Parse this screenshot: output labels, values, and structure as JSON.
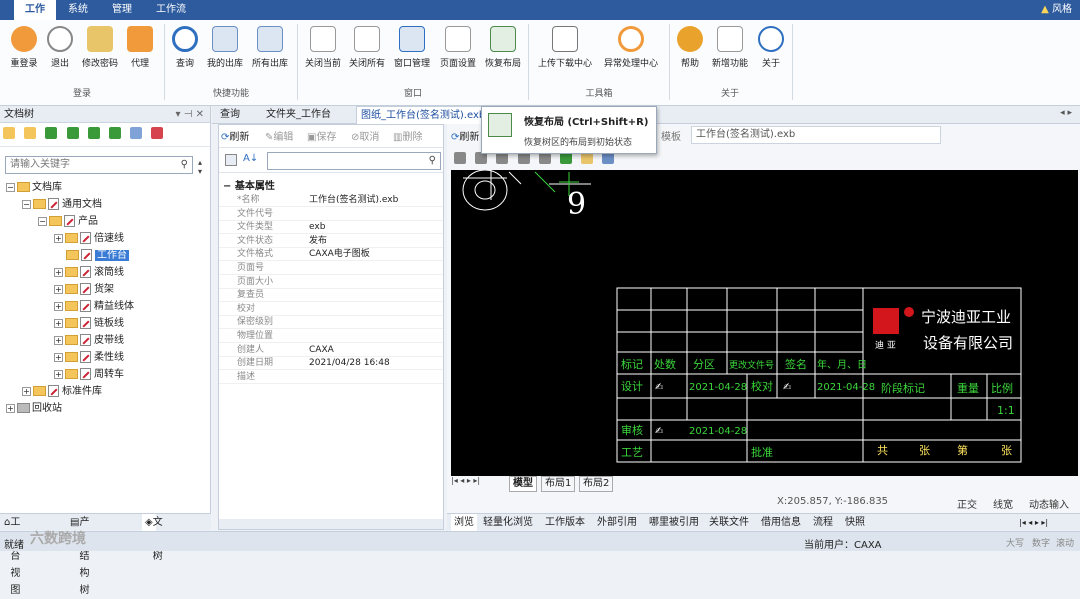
{
  "menubar": {
    "tabs": [
      "工作",
      "系统",
      "管理",
      "工作流"
    ],
    "style": "风格"
  },
  "ribbon": {
    "buttons": [
      "重登录",
      "退出",
      "修改密码",
      "代理",
      "查询",
      "我的出库",
      "所有出库",
      "关闭当前",
      "关闭所有",
      "窗口管理",
      "页面设置",
      "恢复布局",
      "上传下载中心",
      "异常处理中心",
      "帮助",
      "新增功能",
      "关于"
    ],
    "groups": [
      "登录",
      "快捷功能",
      "窗口",
      "工具箱",
      "关于"
    ]
  },
  "tree": {
    "title": "文档树",
    "search_placeholder": "请输入关键字",
    "nodes": [
      "文档库",
      "通用文档",
      "产品",
      "倍速线",
      "工作台",
      "滚筒线",
      "货架",
      "精益线体",
      "链板线",
      "皮带线",
      "柔性线",
      "周转车",
      "标准件库",
      "回收站"
    ],
    "bottom_tabs": [
      "工作台视图",
      "产品结构树",
      "文档树"
    ]
  },
  "doc_tabs": [
    "查询",
    "文件夹_工作台",
    "图纸_工作台(签名测试).exb"
  ],
  "prop": {
    "toolbar": [
      "刷新",
      "编辑",
      "保存",
      "取消",
      "删除"
    ],
    "section": "基本属性",
    "rows": [
      {
        "k": "*名称",
        "v": "工作台(签名测试).exb"
      },
      {
        "k": "文件代号",
        "v": ""
      },
      {
        "k": "文件类型",
        "v": "exb"
      },
      {
        "k": "文件状态",
        "v": "发布"
      },
      {
        "k": "文件格式",
        "v": "CAXA电子图板"
      },
      {
        "k": "页面号",
        "v": ""
      },
      {
        "k": "页面大小",
        "v": ""
      },
      {
        "k": "复查员",
        "v": ""
      },
      {
        "k": "校对",
        "v": ""
      },
      {
        "k": "保密级别",
        "v": ""
      },
      {
        "k": "物理位置",
        "v": ""
      },
      {
        "k": "创建人",
        "v": "CAXA"
      },
      {
        "k": "创建日期",
        "v": "2021/04/28 16:48"
      },
      {
        "k": "描述",
        "v": ""
      }
    ]
  },
  "viewer": {
    "refresh": "刷新",
    "template": "模板",
    "filename": "工作台(签名测试).exb",
    "layout_tabs": [
      "模型",
      "布局1",
      "布局2"
    ],
    "coords": "X:205.857, Y:-186.835",
    "modes": [
      "正交",
      "线宽",
      "动态输入"
    ],
    "bottom_tabs": [
      "浏览",
      "轻量化浏览",
      "工作版本",
      "外部引用",
      "哪里被引用",
      "关联文件",
      "借用信息",
      "流程",
      "快照"
    ],
    "drawing": {
      "number": "9",
      "company_line1": "宁波迪亚工业",
      "company_line2": "设备有限公司",
      "logo_sub": "迪 亚",
      "header": [
        "标记",
        "处数",
        "分区",
        "更改文件号",
        "签名",
        "年、月、日"
      ],
      "row_design": [
        "设计",
        "2021-04-28",
        "校对",
        "2021-04-28"
      ],
      "row_review": [
        "审核",
        "2021-04-28"
      ],
      "row_process": [
        "工艺",
        "批准"
      ],
      "stage": [
        "阶段标记",
        "重量",
        "比例"
      ],
      "scale": "1:1",
      "sheet": [
        "共",
        "张",
        "第",
        "张"
      ]
    }
  },
  "tooltip": {
    "title": "恢复布局 (Ctrl+Shift+R)",
    "desc": "恢复树区的布局到初始状态"
  },
  "status": {
    "left": "就绪",
    "user": "当前用户：CAXA",
    "keys": [
      "大写",
      "数字",
      "滚动"
    ]
  },
  "watermark": "六数跨境",
  "colors": {
    "menubar": "#2d5b9e",
    "canvas": "#000000",
    "grid_green": "#3bd63b",
    "logo_red": "#d2161b"
  }
}
